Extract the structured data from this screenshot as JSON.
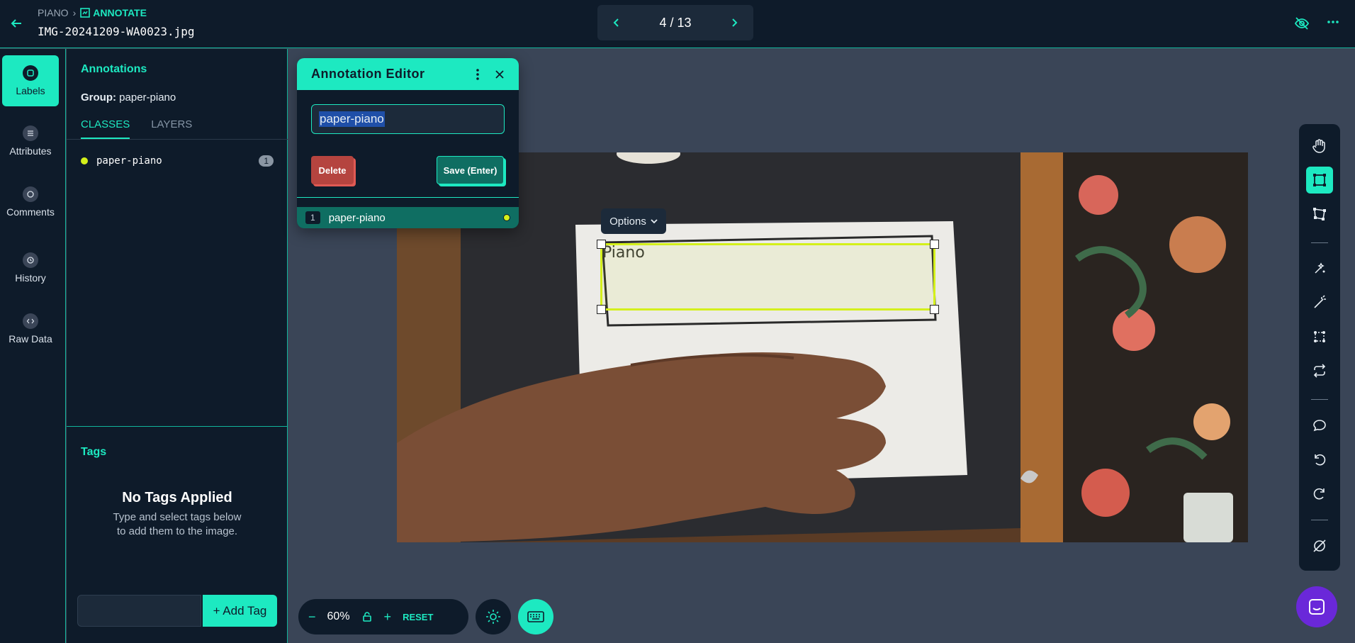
{
  "header": {
    "project": "PIANO",
    "section": "ANNOTATE",
    "filename": "IMG-20241209-WA0023.jpg",
    "pager": "4 / 13"
  },
  "rail": {
    "items": [
      {
        "label": "Labels",
        "icon": "tag-icon",
        "active": true
      },
      {
        "label": "Attributes",
        "icon": "list-icon",
        "active": false
      },
      {
        "label": "Comments",
        "icon": "comment-icon",
        "active": false
      },
      {
        "label": "History",
        "icon": "history-icon",
        "active": false
      },
      {
        "label": "Raw Data",
        "icon": "code-icon",
        "active": false
      }
    ]
  },
  "panel": {
    "title": "Annotations",
    "group_label": "Group:",
    "group_value": "paper-piano",
    "tabs": [
      "CLASSES",
      "LAYERS"
    ],
    "classes": [
      {
        "name": "paper-piano",
        "count": "1",
        "color": "#d4f01a"
      }
    ],
    "tags_title": "Tags",
    "no_tags_title": "No Tags Applied",
    "no_tags_desc": "Type and select tags below to add them to the image.",
    "add_tag_label": "+ Add Tag"
  },
  "canvas": {
    "options_label": "Options",
    "sketch_text": "Piano"
  },
  "editor": {
    "title": "Annotation Editor",
    "input_value": "paper-piano",
    "delete_label": "Delete",
    "save_label": "Save (Enter)",
    "row_num": "1",
    "row_name": "paper-piano"
  },
  "zoom": {
    "value": "60%",
    "reset_label": "RESET"
  },
  "colors": {
    "accent": "#1de9c1",
    "class_color": "#d4f01a",
    "bg_dark": "#0e1b2a",
    "canvas_bg": "#3a4557"
  }
}
